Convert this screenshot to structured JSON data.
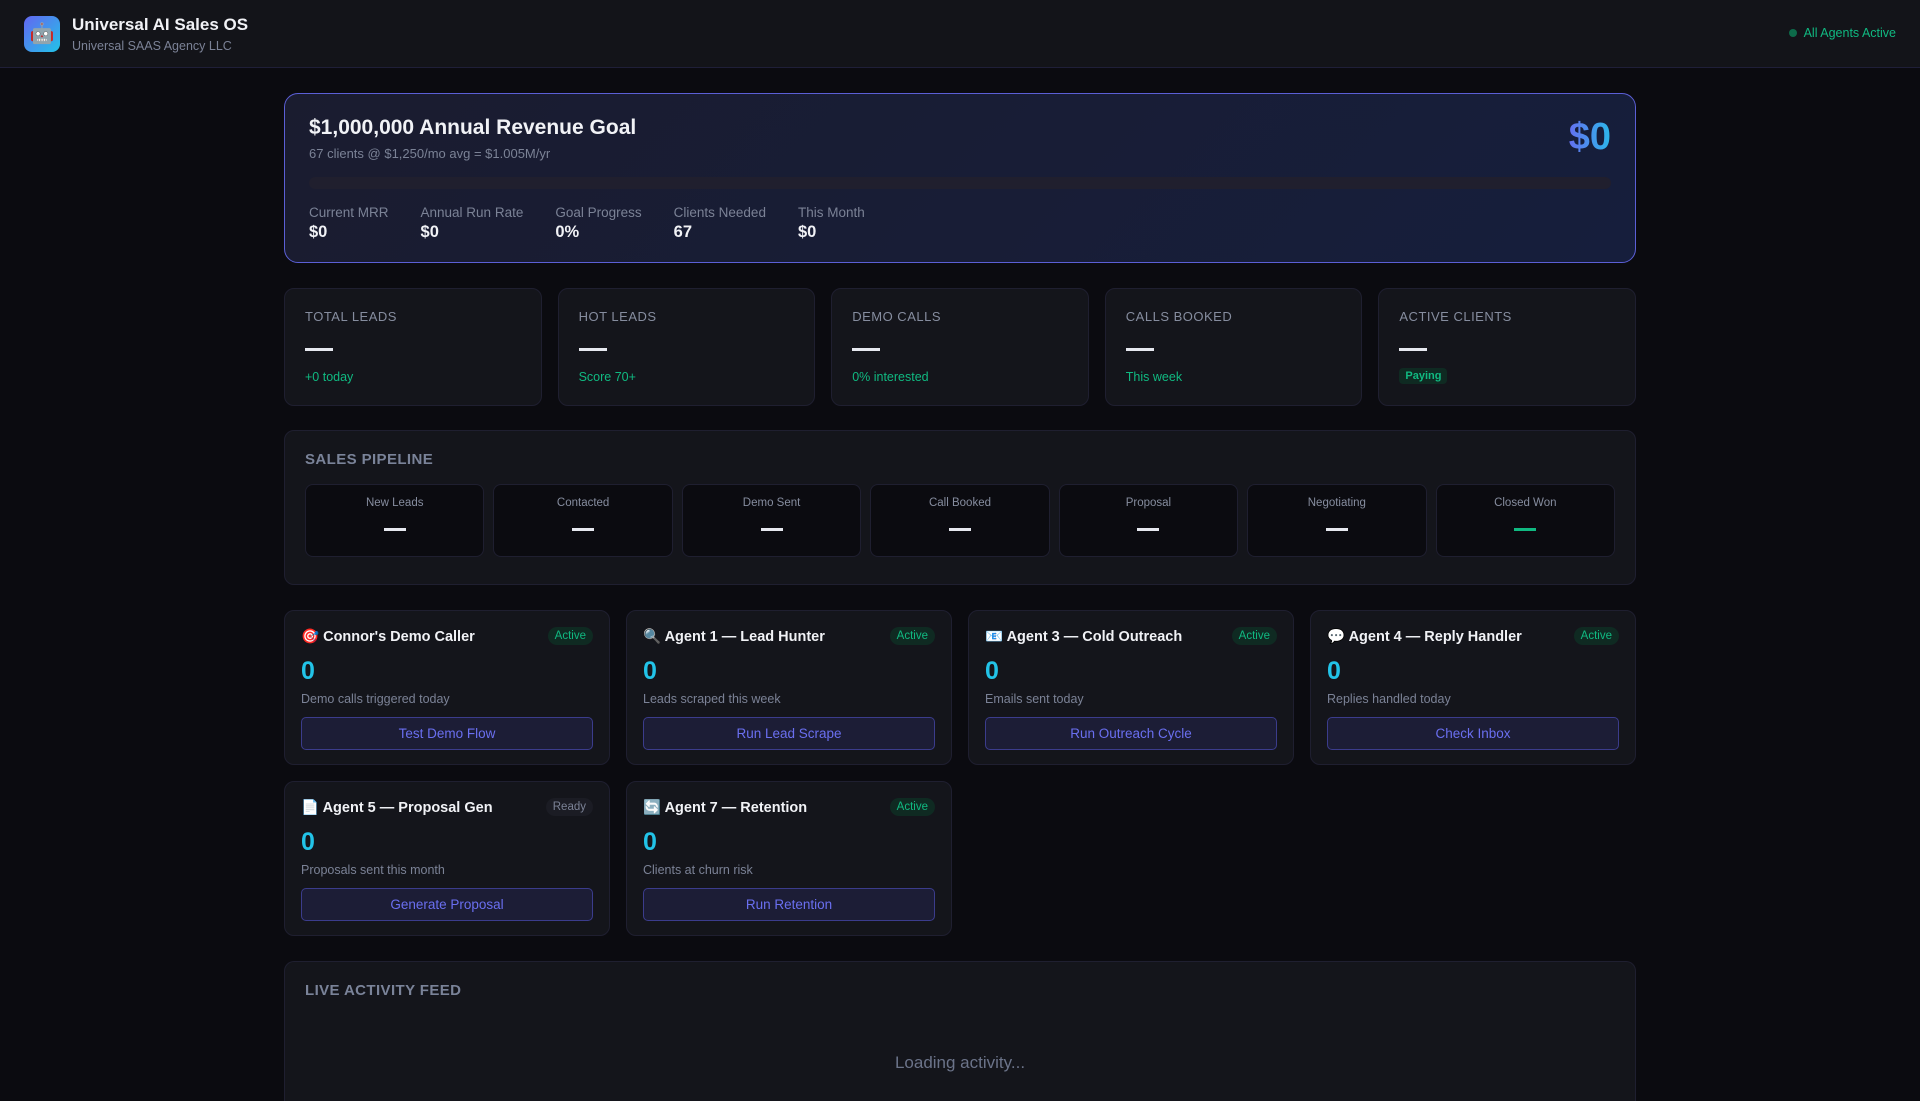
{
  "header": {
    "logo_icon": "🤖",
    "title": "Universal AI Sales OS",
    "subtitle": "Universal SAAS Agency LLC",
    "status": "All Agents Active"
  },
  "revenue": {
    "title": "$1,000,000 Annual Revenue Goal",
    "subtitle": "67 clients @ $1,250/mo avg = $1.005M/yr",
    "total": "$0",
    "progress_percent": 0,
    "stats": [
      {
        "label": "Current MRR",
        "value": "$0"
      },
      {
        "label": "Annual Run Rate",
        "value": "$0"
      },
      {
        "label": "Goal Progress",
        "value": "0%"
      },
      {
        "label": "Clients Needed",
        "value": "67"
      },
      {
        "label": "This Month",
        "value": "$0"
      }
    ]
  },
  "stats": [
    {
      "label": "TOTAL LEADS",
      "value": "—",
      "sub": "+0 today"
    },
    {
      "label": "HOT LEADS",
      "value": "—",
      "sub": "Score 70+"
    },
    {
      "label": "DEMO CALLS",
      "value": "—",
      "sub": "0% interested"
    },
    {
      "label": "CALLS BOOKED",
      "value": "—",
      "sub": "This week"
    },
    {
      "label": "ACTIVE CLIENTS",
      "value": "—",
      "sub": "Paying"
    }
  ],
  "pipeline": {
    "title": "SALES PIPELINE",
    "stages": [
      {
        "label": "New Leads",
        "value": "—"
      },
      {
        "label": "Contacted",
        "value": "—"
      },
      {
        "label": "Demo Sent",
        "value": "—"
      },
      {
        "label": "Call Booked",
        "value": "—"
      },
      {
        "label": "Proposal",
        "value": "—"
      },
      {
        "label": "Negotiating",
        "value": "—"
      },
      {
        "label": "Closed Won",
        "value": "—"
      }
    ]
  },
  "agents": [
    {
      "icon": "🎯",
      "name": "Connor's Demo Caller",
      "status": "Active",
      "value": "0",
      "desc": "Demo calls triggered today",
      "button": "Test Demo Flow"
    },
    {
      "icon": "🔍",
      "name": "Agent 1 — Lead Hunter",
      "status": "Active",
      "value": "0",
      "desc": "Leads scraped this week",
      "button": "Run Lead Scrape"
    },
    {
      "icon": "📧",
      "name": "Agent 3 — Cold Outreach",
      "status": "Active",
      "value": "0",
      "desc": "Emails sent today",
      "button": "Run Outreach Cycle"
    },
    {
      "icon": "💬",
      "name": "Agent 4 — Reply Handler",
      "status": "Active",
      "value": "0",
      "desc": "Replies handled today",
      "button": "Check Inbox"
    },
    {
      "icon": "📄",
      "name": "Agent 5 — Proposal Gen",
      "status": "Ready",
      "value": "0",
      "desc": "Proposals sent this month",
      "button": "Generate Proposal"
    },
    {
      "icon": "🔄",
      "name": "Agent 7 — Retention",
      "status": "Active",
      "value": "0",
      "desc": "Clients at churn risk",
      "button": "Run Retention"
    }
  ],
  "feed": {
    "title": "LIVE ACTIVITY FEED",
    "loading": "Loading activity..."
  }
}
